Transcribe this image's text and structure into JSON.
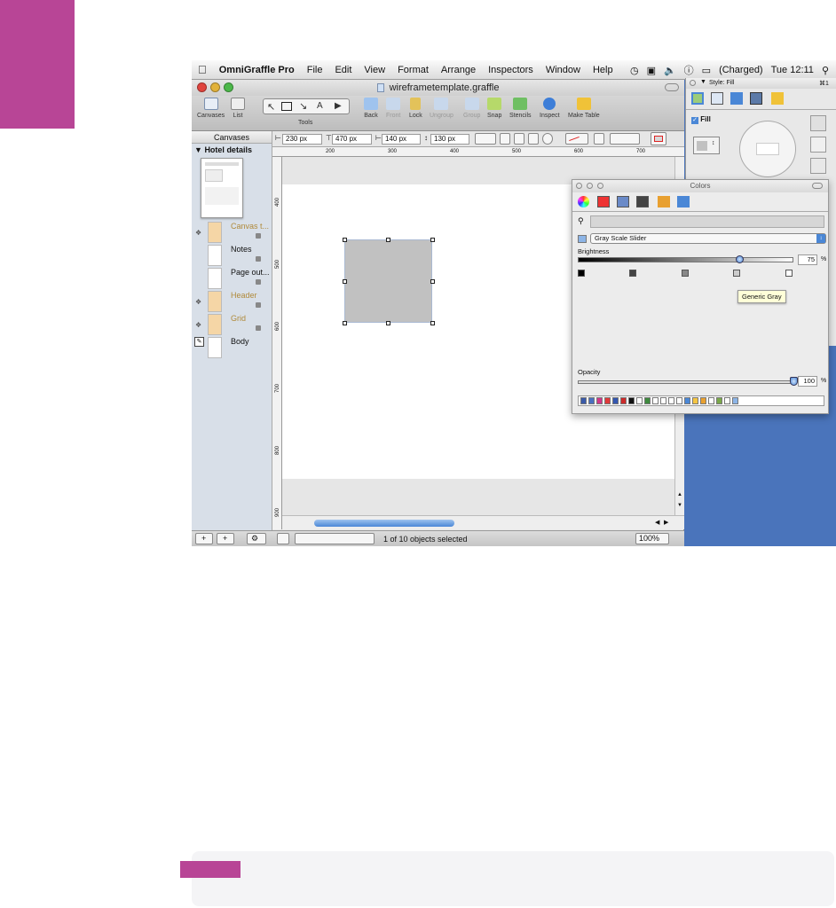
{
  "menubar": {
    "app_name": "OmniGraffle Pro",
    "items": [
      "File",
      "Edit",
      "View",
      "Format",
      "Arrange",
      "Inspectors",
      "Window",
      "Help"
    ],
    "battery": "(Charged)",
    "clock": "Tue 12:11"
  },
  "window": {
    "title": "wireframetemplate.graffle"
  },
  "toolbar": {
    "canvases": "Canvases",
    "list": "List",
    "tools": "Tools",
    "back": "Back",
    "front": "Front",
    "lock": "Lock",
    "ungroup": "Ungroup",
    "group": "Group",
    "snap": "Snap",
    "stencils": "Stencils",
    "inspect": "Inspect",
    "make_table": "Make Table"
  },
  "sidebar": {
    "header": "Canvases",
    "canvas_name": "Hotel details",
    "layers": [
      {
        "name": "Canvas t...",
        "color": "#b08a3a"
      },
      {
        "name": "Notes",
        "color": "#111111"
      },
      {
        "name": "Page out...",
        "color": "#111111"
      },
      {
        "name": "Header",
        "color": "#b08a3a"
      },
      {
        "name": "Grid",
        "color": "#b08a3a"
      },
      {
        "name": "Body",
        "color": "#111111"
      }
    ]
  },
  "geometry_bar": {
    "x": "230 px",
    "y": "470 px",
    "width": "140 px",
    "height": "130 px"
  },
  "rulers": {
    "top": [
      "200",
      "300",
      "400",
      "500",
      "600",
      "700"
    ],
    "left": [
      "400",
      "500",
      "600",
      "700",
      "800",
      "900"
    ]
  },
  "statusbar": {
    "selection": "1 of 10 objects selected",
    "zoom": "100%"
  },
  "inspector": {
    "title": "Style: Fill",
    "shortcut": "⌘1",
    "fill_label": "Fill",
    "fill_checked": true
  },
  "colors_panel": {
    "title": "Colors",
    "mode": "Gray Scale Slider",
    "brightness_label": "Brightness",
    "brightness_value": "75",
    "percent": "%",
    "tooltip": "Generic Gray",
    "opacity_label": "Opacity",
    "opacity_value": "100",
    "brightness_level": 0.75,
    "opacity_level": 1.0,
    "swatches": [
      "#3a5aa8",
      "#4a6fc0",
      "#d2388a",
      "#e03a3a",
      "#3356b0",
      "#cc2a2a",
      "#111111",
      "#ffffff",
      "#3e8a3e",
      "#ffffff",
      "#ffffff",
      "#ffffff",
      "#ffffff",
      "#4a87d6",
      "#f5c542",
      "#e8a030",
      "#ffffff",
      "#7aa84a",
      "#ffffff",
      "#8cb4e6"
    ]
  },
  "accent": {
    "magenta": "#b84596",
    "desktop_blue": "#4a74bb"
  }
}
